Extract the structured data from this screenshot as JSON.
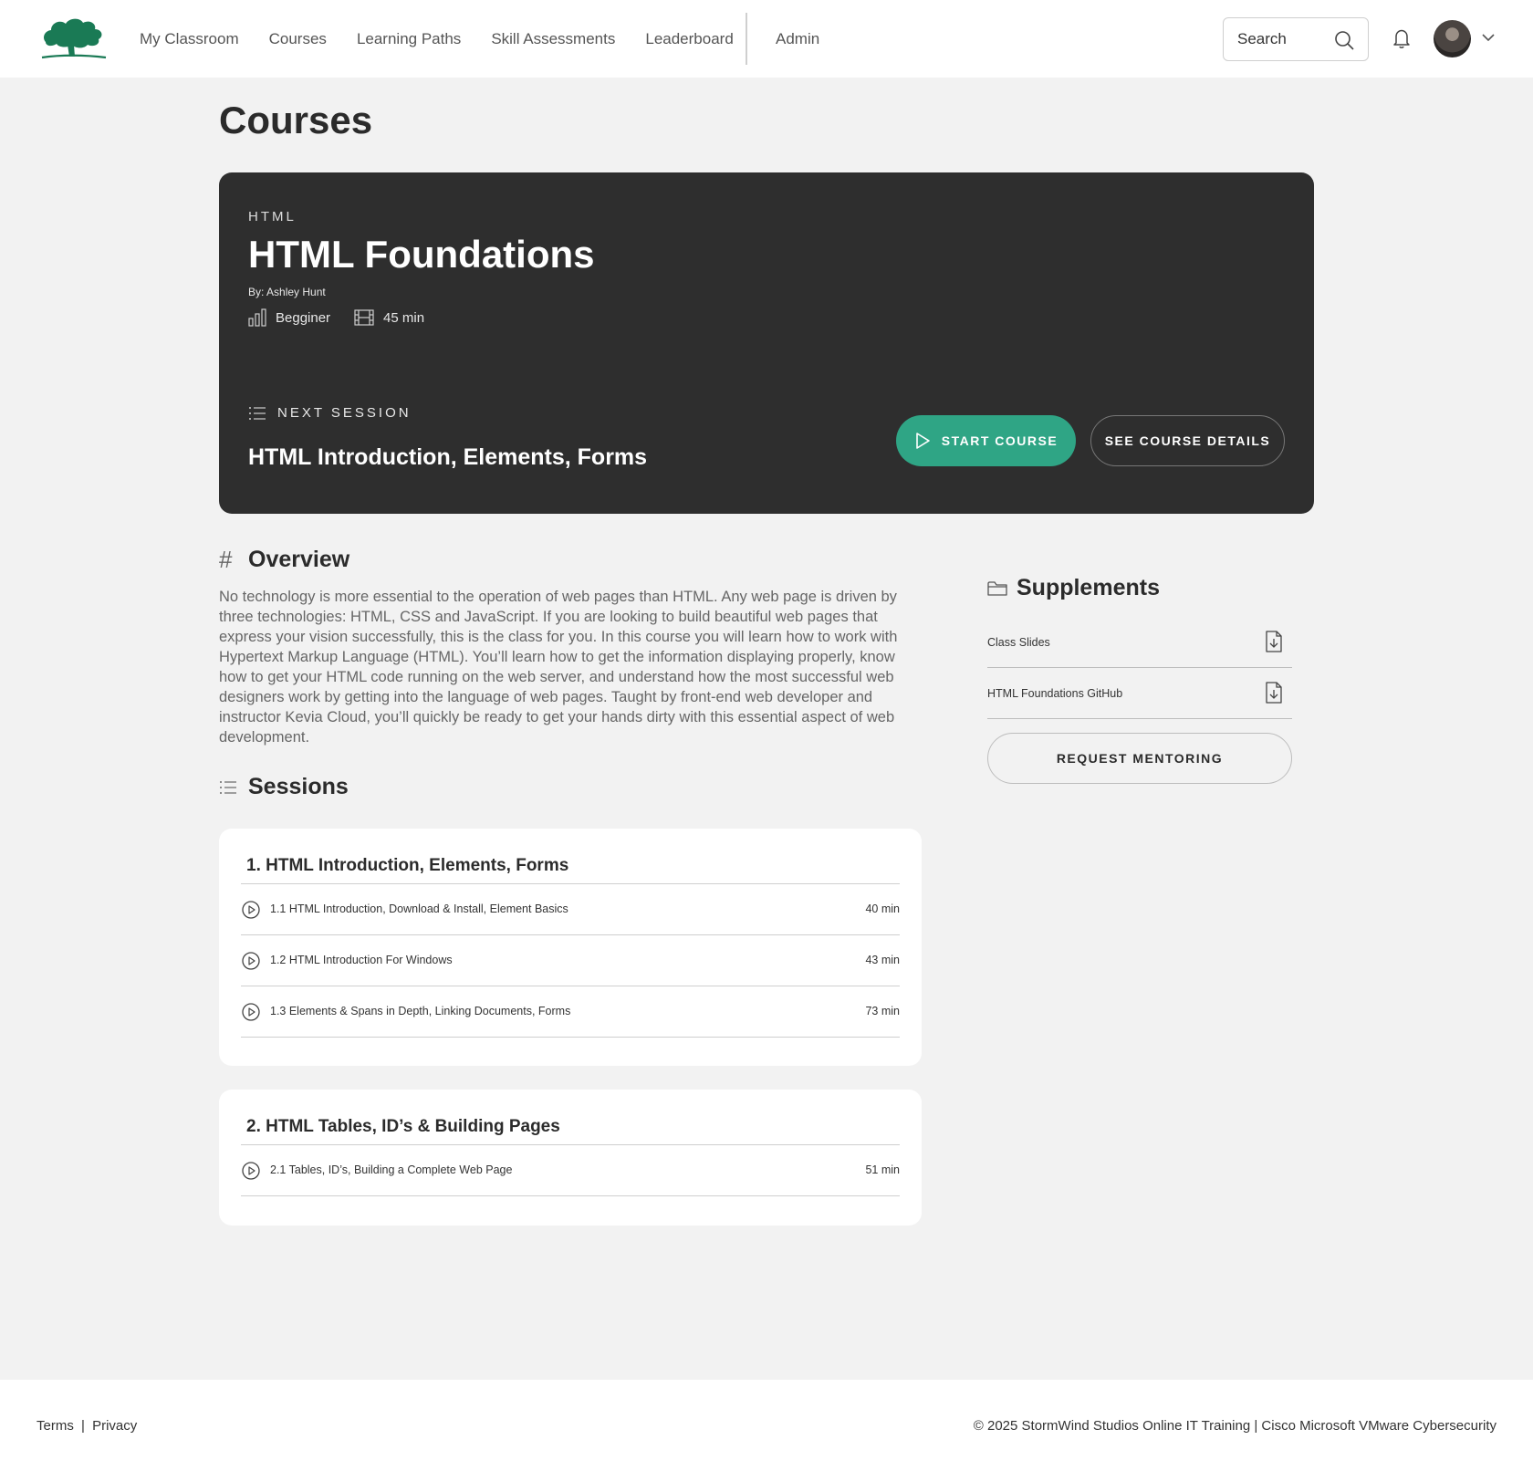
{
  "nav": {
    "items": [
      "My Classroom",
      "Courses",
      "Learning Paths",
      "Skill Assessments",
      "Leaderboard"
    ],
    "admin": "Admin",
    "search_placeholder": "Search"
  },
  "page": {
    "title": "Courses"
  },
  "hero": {
    "category": "HTML",
    "title": "HTML Foundations",
    "author": "By: Ashley Hunt",
    "level": "Begginer",
    "duration": "45 min",
    "next_label": "NEXT SESSION",
    "next_title": "HTML Introduction, Elements, Forms",
    "start_label": "START COURSE",
    "details_label": "SEE COURSE DETAILS"
  },
  "overview": {
    "heading": "Overview",
    "text": "No technology is more essential to the operation of web pages than HTML. Any web page is driven by three technologies: HTML, CSS and JavaScript. If you are looking to build beautiful web pages that express your vision successfully, this is the class for you. In this course you will learn how to work with Hypertext Markup Language (HTML). You’ll learn how to get the information displaying properly, know how to get your HTML code running on the web server, and understand how the most successful web designers work by getting into the language of web pages.  Taught by front-end web developer and instructor Kevia Cloud, you’ll quickly be ready to get your hands dirty with this essential aspect of web development."
  },
  "sessions": {
    "heading": "Sessions",
    "groups": [
      {
        "title": "1. HTML Introduction, Elements, Forms",
        "lessons": [
          {
            "name": "1.1 HTML Introduction, Download & Install, Element Basics",
            "duration": "40 min"
          },
          {
            "name": "1.2 HTML Introduction For Windows",
            "duration": "43 min"
          },
          {
            "name": "1.3 Elements & Spans in Depth, Linking Documents, Forms",
            "duration": "73 min"
          }
        ]
      },
      {
        "title": "2. HTML Tables, ID’s & Building Pages",
        "lessons": [
          {
            "name": "2.1 Tables, ID’s, Building a Complete Web Page",
            "duration": "51 min"
          }
        ]
      }
    ]
  },
  "supplements": {
    "heading": "Supplements",
    "items": [
      "Class Slides",
      "HTML Foundations GitHub"
    ],
    "mentoring_label": "REQUEST MENTORING"
  },
  "footer": {
    "terms": "Terms",
    "separator": "|",
    "privacy": "Privacy",
    "copyright": "© 2025 StormWind Studios Online IT Training | Cisco Microsoft VMware Cybersecurity"
  },
  "colors": {
    "brand_green": "#1a7a55",
    "accent_green": "#2fa585",
    "hero_bg": "#2e2e2e",
    "page_bg": "#f2f2f2"
  }
}
